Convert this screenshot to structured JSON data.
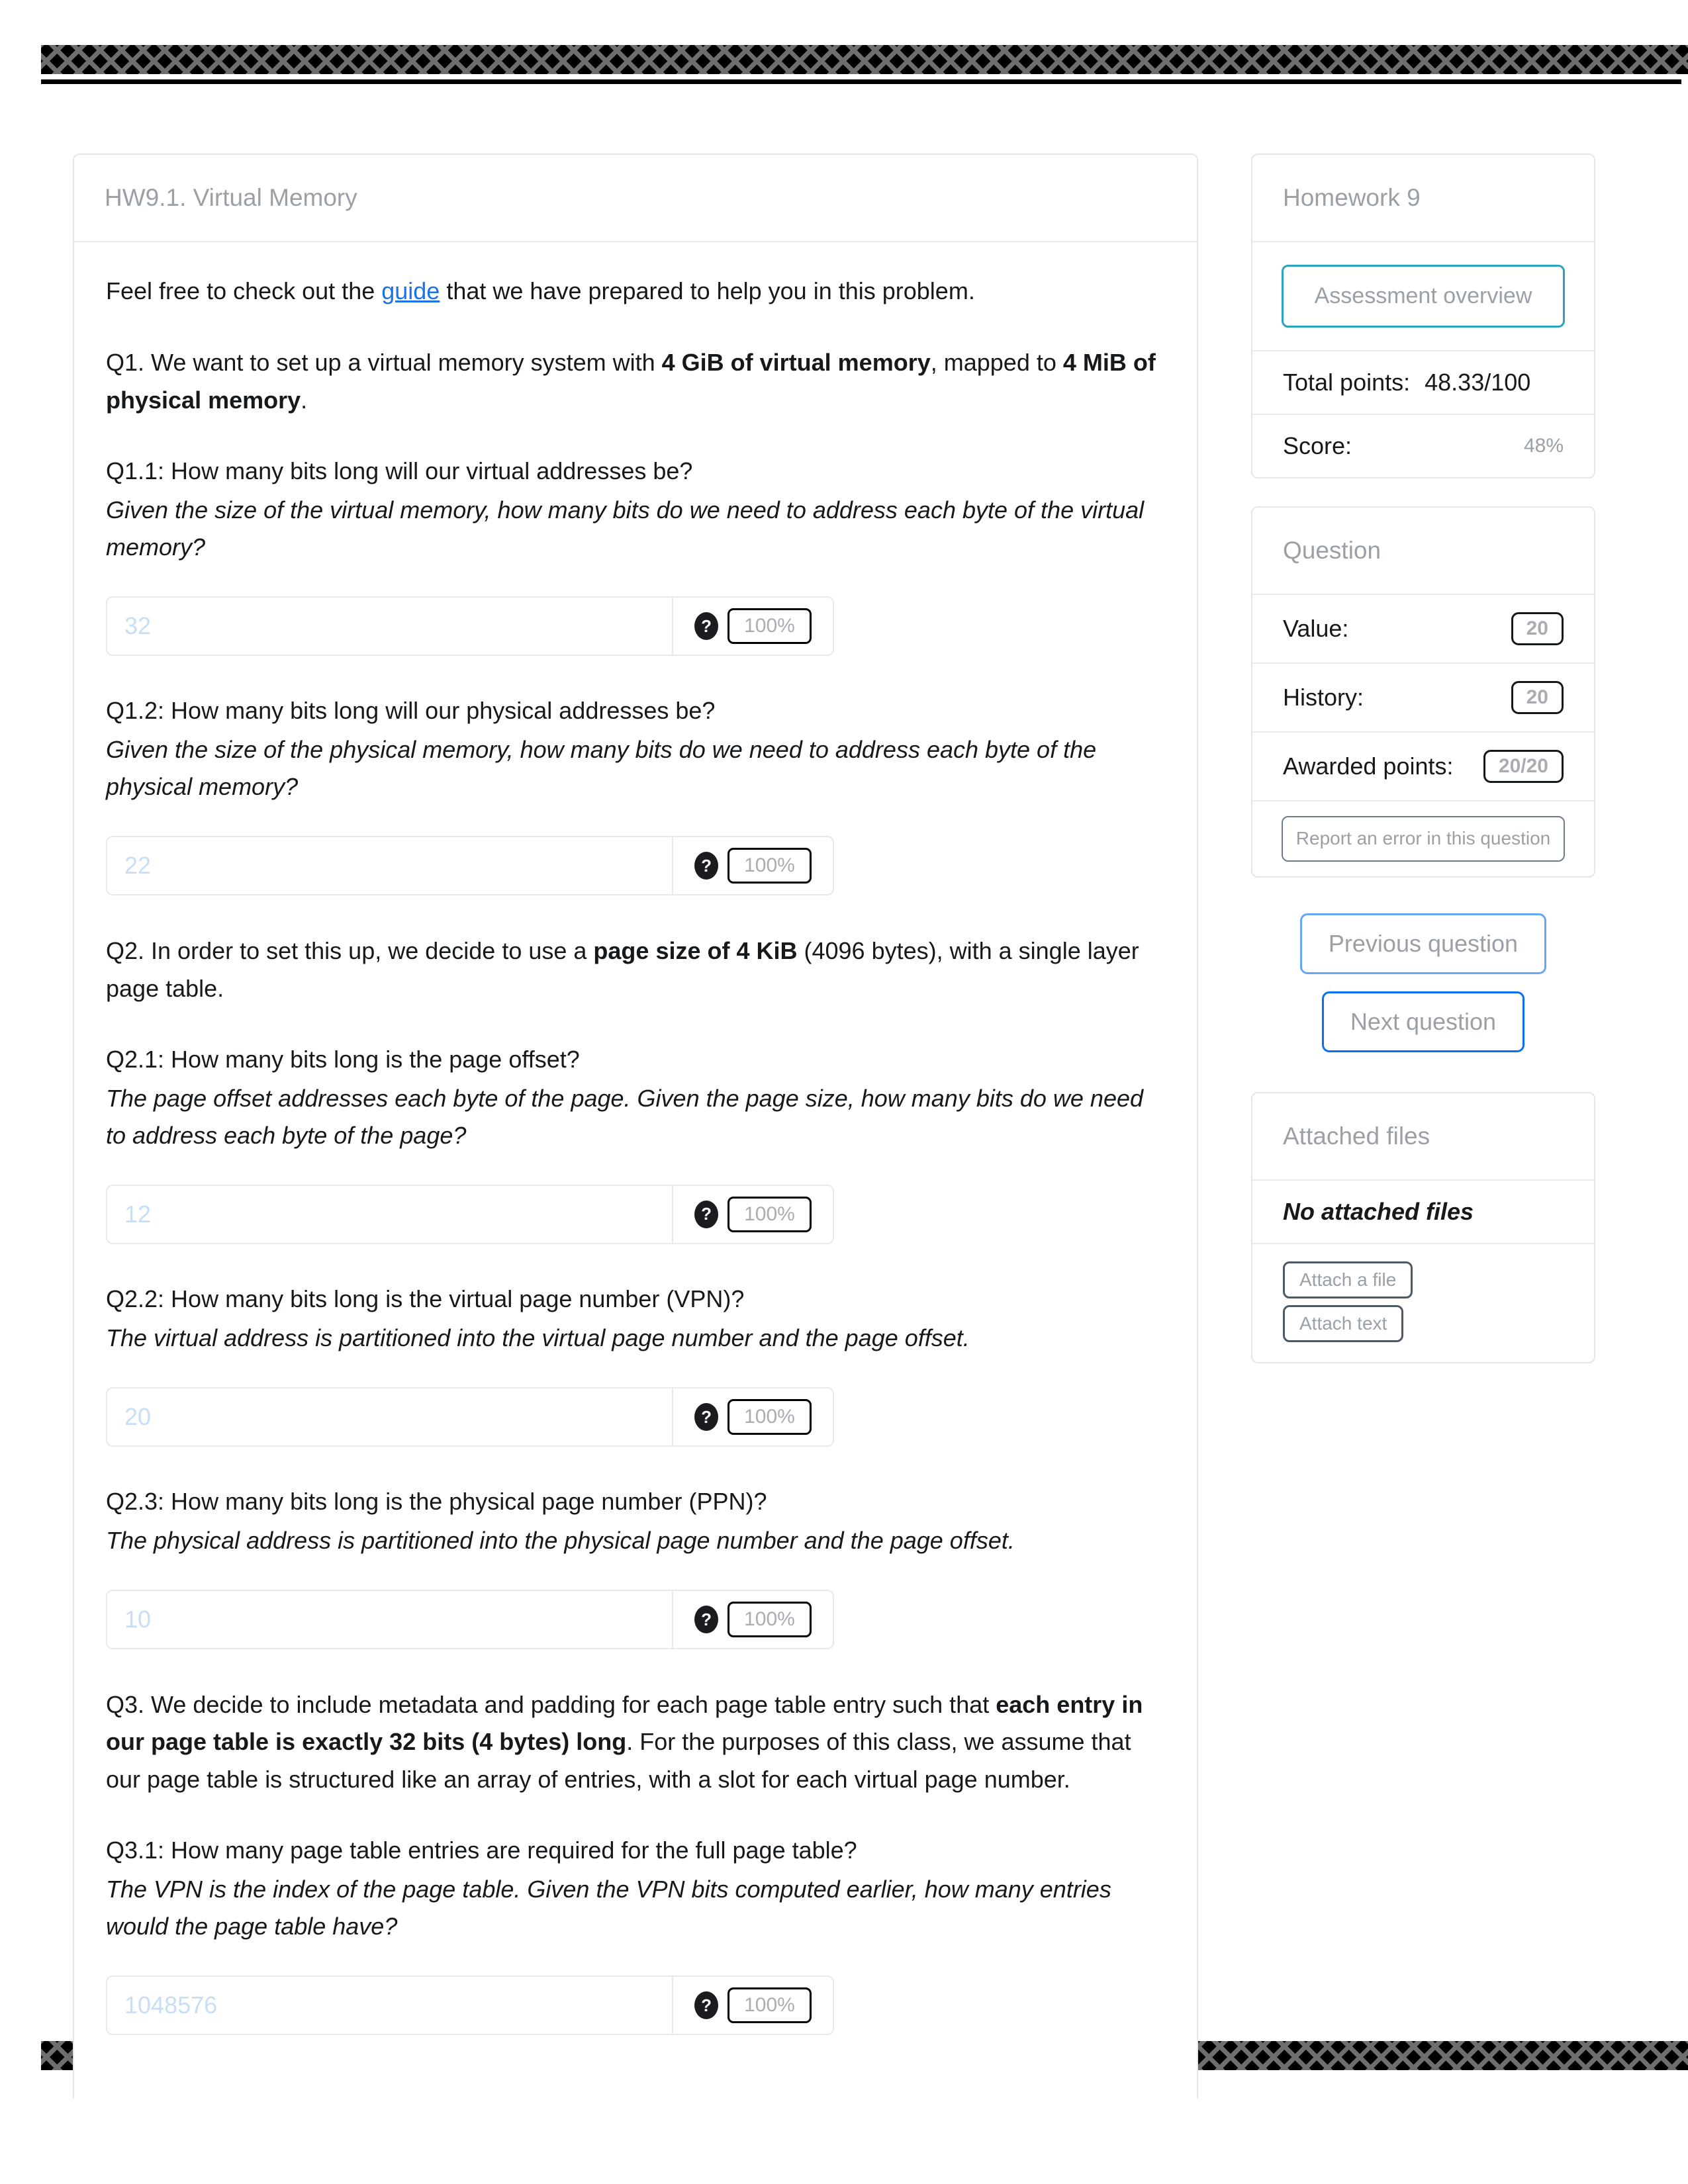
{
  "question_card": {
    "title": "HW9.1. Virtual Memory",
    "intro_prefix": "Feel free to check out the ",
    "intro_link": "guide",
    "intro_suffix": " that we have prepared to help you in this problem.",
    "q1_part1": "Q1. We want to set up a virtual memory system with ",
    "q1_bold1": "4 GiB of virtual memory",
    "q1_part2": ", mapped to ",
    "q1_bold2": "4 MiB of physical memory",
    "q1_part3": ".",
    "q1_1_head": "Q1.1: How many bits long will our virtual addresses be?",
    "q1_1_sub": "Given the size of the virtual memory, how many bits do we need to address each byte of the virtual memory?",
    "q1_1_answer": "32",
    "q1_1_score": "100%",
    "q1_2_head": "Q1.2: How many bits long will our physical addresses be?",
    "q1_2_sub": "Given the size of the physical memory, how many bits do we need to address each byte of the physical memory?",
    "q1_2_answer": "22",
    "q1_2_score": "100%",
    "q2_part1": "Q2. In order to set this up, we decide to use a ",
    "q2_bold1": "page size of 4 KiB",
    "q2_part2": " (4096 bytes), with a single layer page table.",
    "q2_1_head": "Q2.1: How many bits long is the page offset?",
    "q2_1_sub": "The page offset addresses each byte of the page. Given the page size, how many bits do we need to address each byte of the page?",
    "q2_1_answer": "12",
    "q2_1_score": "100%",
    "q2_2_head": "Q2.2: How many bits long is the virtual page number (VPN)?",
    "q2_2_sub": "The virtual address is partitioned into the virtual page number and the page offset.",
    "q2_2_answer": "20",
    "q2_2_score": "100%",
    "q2_3_head": "Q2.3: How many bits long is the physical page number (PPN)?",
    "q2_3_sub": "The physical address is partitioned into the physical page number and the page offset.",
    "q2_3_answer": "10",
    "q2_3_score": "100%",
    "q3_part1": "Q3. We decide to include metadata and padding for each page table entry such that ",
    "q3_bold1": "each entry in our page table is exactly 32 bits (4 bytes) long",
    "q3_part2": ". For the purposes of this class, we assume that our page table is structured like an array of entries, with a slot for each virtual page number.",
    "q3_1_head": "Q3.1: How many page table entries are required for the full page table?",
    "q3_1_sub": "The VPN is the index of the page table. Given the VPN bits computed earlier, how many entries would the page table have?",
    "q3_1_answer": "1048576",
    "q3_1_score": "100%",
    "help_icon": "?"
  },
  "sidebar": {
    "assessment": {
      "title": "Homework 9",
      "overview_button": "Assessment overview",
      "total_points_label": "Total points:",
      "total_points_value": "48.33/100",
      "score_label": "Score:",
      "score_value": "48%"
    },
    "question_panel": {
      "title": "Question",
      "value_label": "Value:",
      "value_value": "20",
      "history_label": "History:",
      "history_value": "20",
      "awarded_label": "Awarded points:",
      "awarded_value": "20/20",
      "report_button": "Report an error in this question"
    },
    "navigation": {
      "previous": "Previous question",
      "next": "Next question"
    },
    "attached": {
      "title": "Attached files",
      "empty_text": "No attached files",
      "attach_file_button": "Attach a file",
      "attach_text_button": "Attach text"
    }
  },
  "colors": {
    "accent_teal": "#2aa3bd",
    "accent_blue": "#0a6ff0",
    "link_blue": "#1a73e8",
    "answer_text": "#c8def7"
  }
}
